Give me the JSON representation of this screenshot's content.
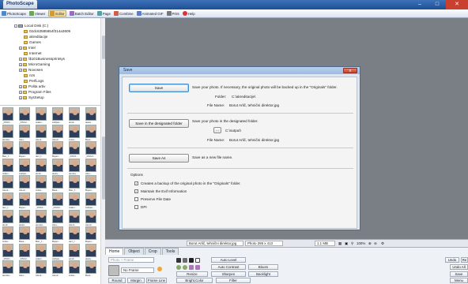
{
  "app": {
    "title": "PhotoScape"
  },
  "toolbar": {
    "items": [
      "PhotoScape",
      "Viewer",
      "Editor",
      "Batch Editor",
      "Page",
      "Combine",
      "Animated GIF",
      "Print",
      "Help"
    ]
  },
  "tree": {
    "items": [
      "Local Disk (C:)",
      "02dc63585654f314a3609",
      "akreditacije",
      "Games",
      "Intel",
      "Internet",
      "\\$101Businessprintsys",
      "MicroGaming",
      "Novosen",
      "nzs",
      "PerfLogs",
      "Polita artiv",
      "Program Files",
      "SysSetup"
    ]
  },
  "thumbnails": {
    "labels": [
      "_DSC1...",
      "_DSC2...",
      "Adam...",
      "Adrijan...",
      "aindr...",
      "aleks...",
      "alenka...",
      "Ales...",
      "Ales1...",
      "Ales2...",
      "Anita...",
      "Bara...",
      "Ban_f...",
      "Bojan...",
      "dez_f...",
      "Bojan..."
    ]
  },
  "dialog": {
    "title": "Save",
    "close_label": "x",
    "save_button": "Save",
    "save_desc": "Save your photo. If necessary, the original photo will be backed up in the \"Originals\" folder.",
    "folder_label": "Folder:",
    "folder_value": "C:\\akreditacije\\",
    "filename_label": "File Name:",
    "filename_value": "Borut Arlič, tehnični direktor.jpg",
    "save_designated_button": "Save in the designated folder",
    "save_designated_desc": "Save your photo in the designated folder.",
    "browse_button": "...",
    "output_folder": "C:\\output\\",
    "filename_label_2": "File Name:",
    "filename_value_2": "Borut Arlič, tehnični direktor.jpg",
    "save_as_button": "Save As",
    "save_as_desc": "Save as a new file name.",
    "options_label": "Options",
    "option_backup": "Creates a backup of the original photo in the \"Originals\" folder.",
    "option_exif": "Maintain the Exif Information",
    "option_date": "Preserve File Date",
    "option_dpi": "DPI"
  },
  "status": {
    "filename": "Borut Arlič, tehnični direktor.jpg",
    "photo_size": "Photo 295 x 413",
    "file_size": "1.1 MB",
    "zoom": "100%"
  },
  "ribbon": {
    "tabs": [
      "Home",
      "Object",
      "Crop",
      "Tools"
    ],
    "photo_frame_placeholder": "Photo + Frame",
    "frame_select": "No Frame",
    "auto_level": "Auto Level",
    "auto_contrast": "Auto Contrast",
    "bloom": "Bloom",
    "resize": "Resize",
    "sharpen": "Sharpen",
    "backlight": "Backlight",
    "round": "Round",
    "margin": "Margin",
    "frame_line": "Frame Line",
    "bright_color": "Bright,Color",
    "filter": "Filter",
    "undo": "Undo",
    "redo": "Re",
    "undo_all": "Undo All",
    "save": "Save",
    "menu": "Menu"
  },
  "colors": {
    "titlebar": "#1e4f95",
    "dialog_bg": "#dce7f3",
    "workspace": "#7a7f86"
  }
}
